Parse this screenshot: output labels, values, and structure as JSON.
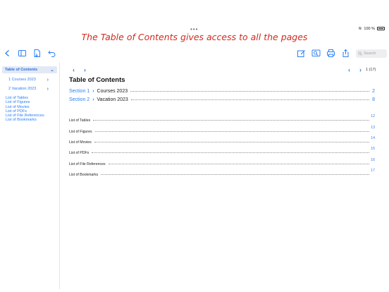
{
  "status": {
    "dots": "•••",
    "battery_text": "100 %"
  },
  "banner": "The Table of Contents gives access to all the pages",
  "search": {
    "placeholder": "Search"
  },
  "sidebar": {
    "header": "Table of Contents",
    "sections": [
      {
        "label": "1 Courses 2023"
      },
      {
        "label": "2 Vacation 2023"
      }
    ],
    "links": [
      "List of Tables",
      "List of Figures",
      "List of Movies",
      "List of PDFs",
      "List of File References",
      "List of Bookmarks"
    ]
  },
  "pager": {
    "count": "1 (17)"
  },
  "document": {
    "title": "Table of Contents",
    "sections": [
      {
        "num": "Section 1",
        "name": "Courses 2023",
        "page": "2"
      },
      {
        "num": "Section 2",
        "name": "Vacation 2023",
        "page": "8"
      }
    ],
    "lists": [
      {
        "label": "List of Tables",
        "page": "12"
      },
      {
        "label": "List of Figures",
        "page": "13"
      },
      {
        "label": "List of Movies",
        "page": "14"
      },
      {
        "label": "List of PDFs",
        "page": "15"
      },
      {
        "label": "List of File References",
        "page": "16"
      },
      {
        "label": "List of Bookmarks",
        "page": "17"
      }
    ]
  },
  "icons": [
    "back-icon",
    "sidebar-icon",
    "document-icon",
    "undo-icon",
    "edit-icon",
    "contents-icon",
    "print-icon",
    "share-icon",
    "search-icon"
  ],
  "colors": {
    "accent": "#2a7ff5",
    "banner": "#d32a1e"
  }
}
